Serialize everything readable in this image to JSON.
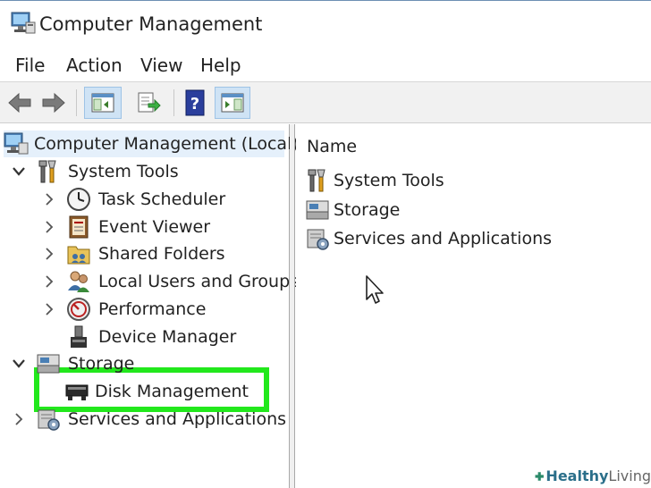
{
  "window": {
    "title": "Computer Management"
  },
  "menubar": {
    "items": [
      "File",
      "Action",
      "View",
      "Help"
    ]
  },
  "toolbar": {
    "buttons": [
      {
        "icon": "back-arrow-icon"
      },
      {
        "icon": "forward-arrow-icon"
      },
      {
        "icon": "show-hide-console-tree-icon",
        "pressed": true
      },
      {
        "icon": "export-list-icon"
      },
      {
        "icon": "help-icon"
      },
      {
        "icon": "show-hide-action-pane-icon",
        "pressed": true
      }
    ]
  },
  "tree": {
    "root": {
      "label": "Computer Management (Local)",
      "icon": "computer-management-icon"
    },
    "system_tools": {
      "label": "System Tools",
      "icon": "tools-icon",
      "expanded": true
    },
    "task_scheduler": {
      "label": "Task Scheduler",
      "icon": "clock-icon"
    },
    "event_viewer": {
      "label": "Event Viewer",
      "icon": "event-viewer-icon"
    },
    "shared_folders": {
      "label": "Shared Folders",
      "icon": "shared-folders-icon"
    },
    "local_users": {
      "label": "Local Users and Groups",
      "icon": "users-icon"
    },
    "performance": {
      "label": "Performance",
      "icon": "performance-icon"
    },
    "device_manager": {
      "label": "Device Manager",
      "icon": "device-manager-icon"
    },
    "storage": {
      "label": "Storage",
      "icon": "storage-icon",
      "expanded": true
    },
    "disk_management": {
      "label": "Disk Management",
      "icon": "disk-icon",
      "highlighted": true
    },
    "services": {
      "label": "Services and Applications",
      "icon": "services-icon"
    }
  },
  "list": {
    "header": "Name",
    "rows": [
      {
        "label": "System Tools",
        "icon": "tools-icon"
      },
      {
        "label": "Storage",
        "icon": "storage-icon"
      },
      {
        "label": "Services and Applications",
        "icon": "services-icon"
      }
    ]
  },
  "watermark": {
    "bold": "Healthy",
    "light": "Living"
  },
  "colors": {
    "highlight": "#22e81c",
    "selection": "#e5f0fb",
    "watermark": "#2b6f8a"
  }
}
